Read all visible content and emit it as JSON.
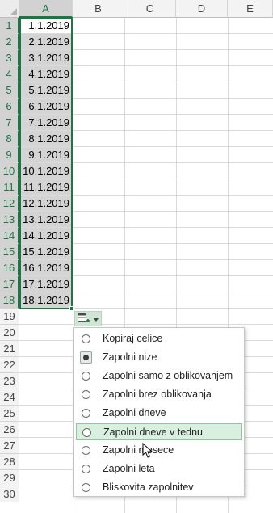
{
  "columns": [
    "A",
    "B",
    "C",
    "D",
    "E"
  ],
  "rows": [
    "1",
    "2",
    "3",
    "4",
    "5",
    "6",
    "7",
    "8",
    "9",
    "10",
    "11",
    "12",
    "13",
    "14",
    "15",
    "16",
    "17",
    "18",
    "19",
    "20",
    "21",
    "22",
    "23",
    "24",
    "25",
    "26",
    "27",
    "28",
    "29",
    "30"
  ],
  "cells_A": [
    "1.1.2019",
    "2.1.2019",
    "3.1.2019",
    "4.1.2019",
    "5.1.2019",
    "6.1.2019",
    "7.1.2019",
    "8.1.2019",
    "9.1.2019",
    "10.1.2019",
    "11.1.2019",
    "12.1.2019",
    "13.1.2019",
    "14.1.2019",
    "15.1.2019",
    "16.1.2019",
    "17.1.2019",
    "18.1.2019"
  ],
  "autofill_button": {
    "icon": "auto-fill-options-icon",
    "dropdown_icon": "chevron-down-icon"
  },
  "menu": {
    "items": [
      {
        "label": "Kopiraj celice",
        "checked": false
      },
      {
        "label": "Zapolni nize",
        "checked": true
      },
      {
        "label": "Zapolni samo z oblikovanjem",
        "checked": false
      },
      {
        "label": "Zapolni brez oblikovanja",
        "checked": false
      },
      {
        "label": "Zapolni dneve",
        "checked": false
      },
      {
        "label": "Zapolni dneve v tednu",
        "checked": false,
        "hovered": true
      },
      {
        "label": "Zapolni mesece",
        "checked": false
      },
      {
        "label": "Zapolni leta",
        "checked": false
      },
      {
        "label": "Bliskovita zapolnitev",
        "checked": false
      }
    ]
  },
  "colors": {
    "selection": "#217346",
    "selected_fill": "#d4d4d4",
    "menu_hover": "#d9efe0"
  }
}
